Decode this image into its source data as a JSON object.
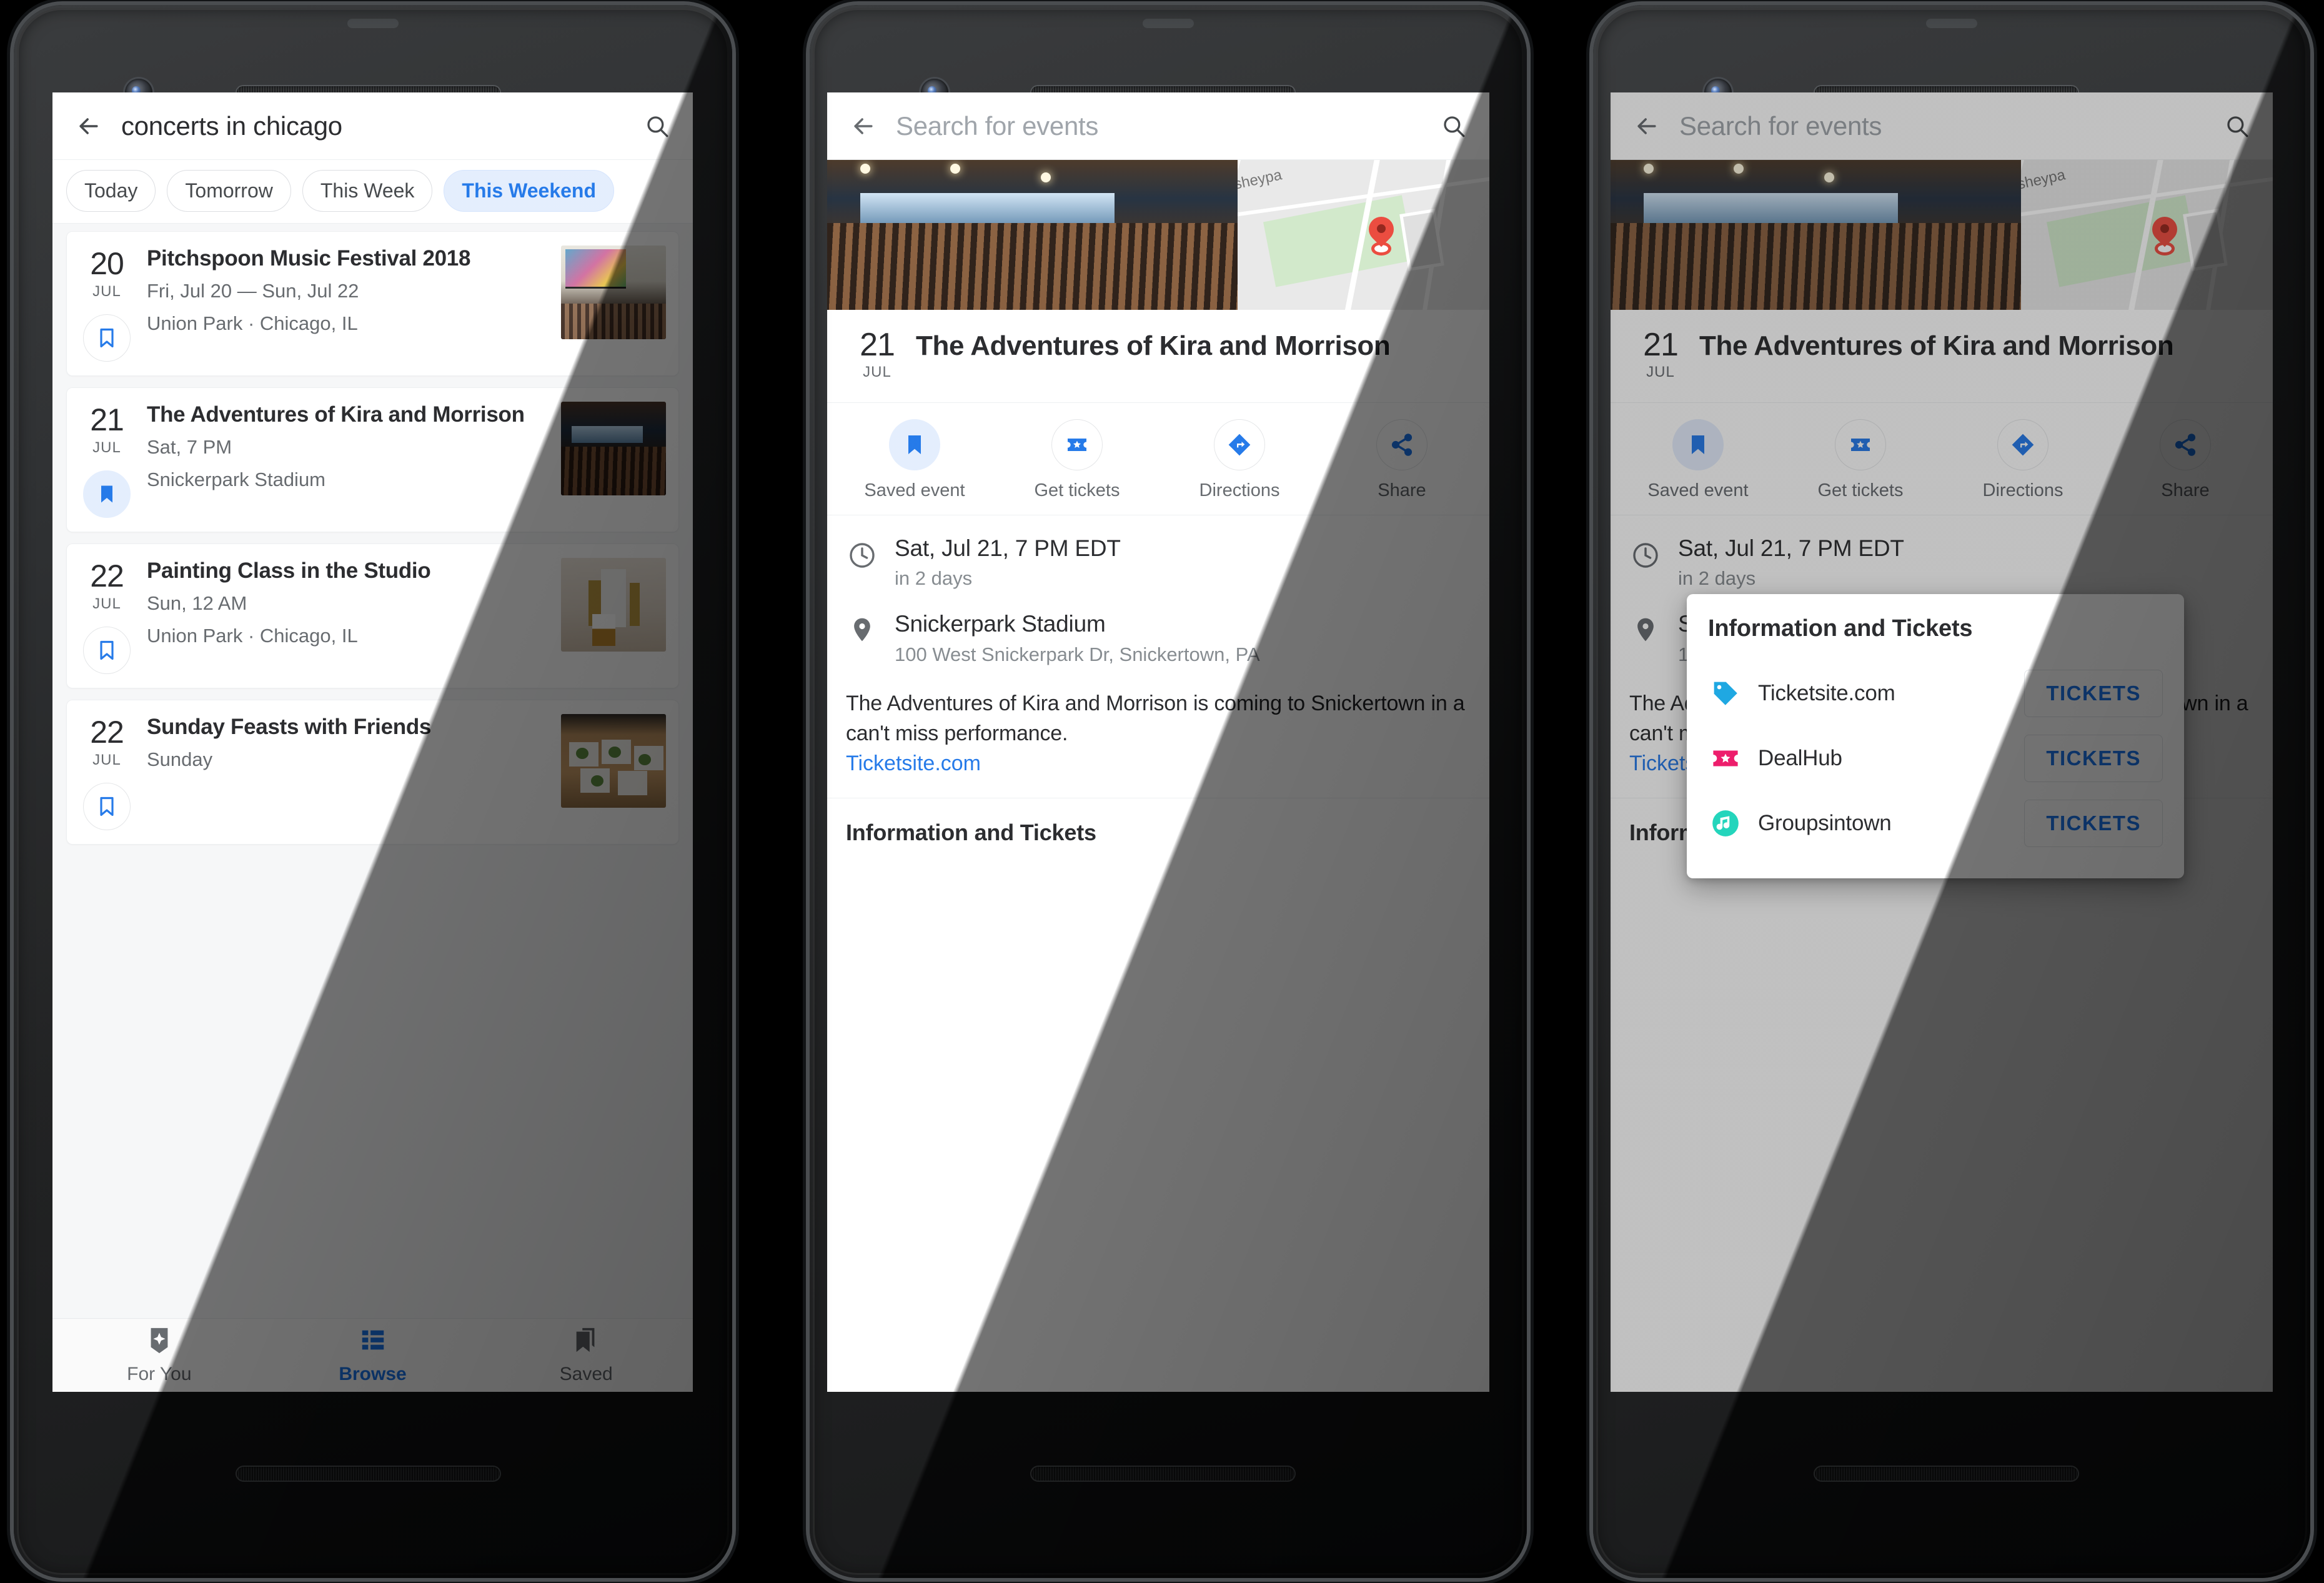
{
  "colors": {
    "accent": "#1a73e8",
    "accent_bg": "#e3edfd",
    "text_primary": "#202124",
    "text_secondary": "#5f6368",
    "pin_red": "#ea4335",
    "ticketsite_blue": "#12a3e0",
    "dealhub_pink": "#ec1164",
    "groupsintown_teal": "#17d3b8"
  },
  "phone1": {
    "search": {
      "query": "concerts in chicago",
      "search_icon": "search-icon",
      "back_icon": "arrow-back-icon"
    },
    "filters": [
      {
        "label": "Today",
        "active": false
      },
      {
        "label": "Tomorrow",
        "active": false
      },
      {
        "label": "This Week",
        "active": false
      },
      {
        "label": "This Weekend",
        "active": true
      }
    ],
    "events": [
      {
        "day": "20",
        "month": "JUL",
        "title": "Pitchspoon Music Festival 2018",
        "line1": "Fri, Jul 20 — Sun, Jul 22",
        "line2": "Union Park · Chicago, IL",
        "saved": false,
        "thumb": "festival-crowd-photo"
      },
      {
        "day": "21",
        "month": "JUL",
        "title": "The Adventures of Kira and Morrison",
        "line1": "Sat, 7 PM",
        "line2": "Snickerpark Stadium",
        "saved": true,
        "thumb": "theatre-audience-photo"
      },
      {
        "day": "22",
        "month": "JUL",
        "title": "Painting Class in the Studio",
        "line1": "Sun, 12 AM",
        "line2": "Union Park · Chicago, IL",
        "saved": false,
        "thumb": "painting-studio-photo"
      },
      {
        "day": "22",
        "month": "JUL",
        "title": "Sunday Feasts with Friends",
        "line1": "Sunday",
        "line2": "",
        "saved": false,
        "thumb": "dinner-table-photo"
      }
    ],
    "bottom_nav": [
      {
        "label": "For You",
        "icon": "sparkle-bookmark-icon",
        "active": false
      },
      {
        "label": "Browse",
        "icon": "list-icon",
        "active": true
      },
      {
        "label": "Saved",
        "icon": "saved-bookmarks-icon",
        "active": false
      }
    ]
  },
  "phone2": {
    "search": {
      "placeholder": "Search for events",
      "search_icon": "search-icon",
      "back_icon": "arrow-back-icon"
    },
    "map_label": "sheypa",
    "event": {
      "day": "21",
      "month": "JUL",
      "title": "The Adventures of Kira and Morrison",
      "datetime": "Sat, Jul 21, 7 PM EDT",
      "relative": "in 2 days",
      "venue": "Snickerpark Stadium",
      "address": "100 West Snickerpark Dr, Snickertown, PA",
      "description": "The Adventures of Kira and Morrison is coming to Snickertown in a can't miss performance.",
      "source_link": "Ticketsite.com"
    },
    "actions": [
      {
        "label": "Saved event",
        "icon": "bookmark-filled-icon",
        "active": true
      },
      {
        "label": "Get tickets",
        "icon": "ticket-star-icon",
        "active": false
      },
      {
        "label": "Directions",
        "icon": "directions-icon",
        "active": false
      },
      {
        "label": "Share",
        "icon": "share-icon",
        "active": false
      }
    ],
    "section_title": "Information and Tickets"
  },
  "phone3": {
    "dialog": {
      "title": "Information and Tickets",
      "providers": [
        {
          "name": "Ticketsite.com",
          "icon": "price-tag-icon",
          "button": "TICKETS"
        },
        {
          "name": "DealHub",
          "icon": "ticket-star-icon",
          "button": "TICKETS"
        },
        {
          "name": "Groupsintown",
          "icon": "music-note-icon",
          "button": "TICKETS"
        }
      ]
    }
  }
}
